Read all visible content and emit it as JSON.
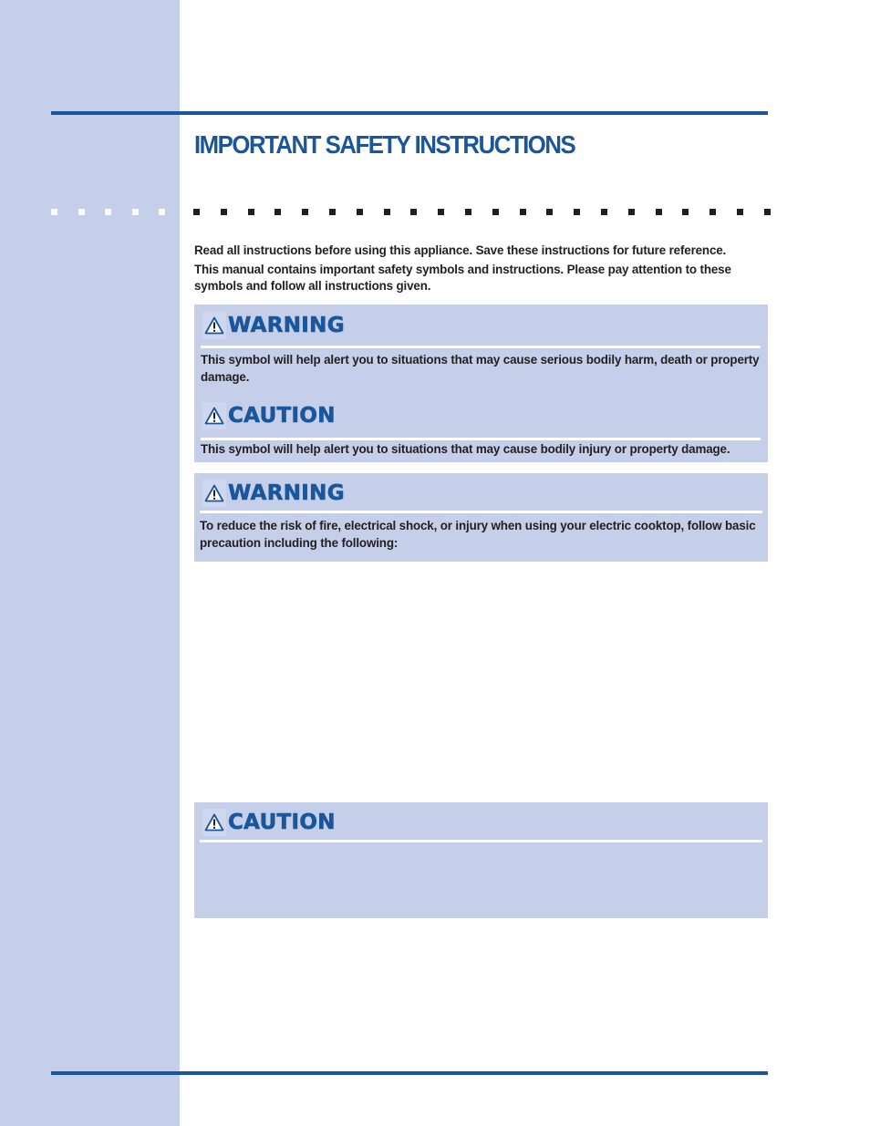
{
  "page": {
    "title": "IMPORTANT SAFETY INSTRUCTIONS",
    "colors": {
      "accent": "#1a569b",
      "sidebar": "#c5cfe9",
      "text": "#231f20",
      "box_background": "#c5cfe9"
    }
  },
  "intro": {
    "line1": "Read all instructions before using this appliance. Save these instructions for future reference.",
    "line2": "This manual contains important safety symbols and instructions. Please pay attention to these symbols and follow all instructions given."
  },
  "symbols_box": {
    "warning": {
      "icon": "warning-triangle-icon",
      "label": "WARNING",
      "text": "This symbol will help alert you to situations that may cause serious bodily harm, death or property damage."
    },
    "caution": {
      "icon": "warning-triangle-icon",
      "label": "CAUTION",
      "text": "This symbol will help alert you to situations that may cause bodily injury or property damage."
    }
  },
  "warning_box": {
    "icon": "warning-triangle-icon",
    "label": "WARNING",
    "text": "To reduce the risk of fire, electrical shock, or injury when using your electric cooktop, follow basic precaution including the following:"
  },
  "caution_box": {
    "icon": "warning-triangle-icon",
    "label": "CAUTION",
    "text": ""
  }
}
